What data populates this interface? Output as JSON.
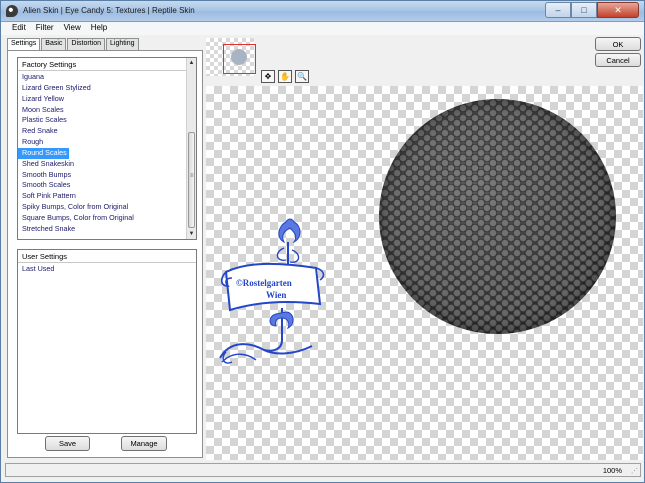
{
  "title": "Alien Skin | Eye Candy 5: Textures | Reptile Skin",
  "window_buttons": {
    "minimize": "–",
    "maximize": "□",
    "close": "✕"
  },
  "menu": [
    "Edit",
    "Filter",
    "View",
    "Help"
  ],
  "tabs": [
    "Settings",
    "Basic",
    "Distortion",
    "Lighting"
  ],
  "factory_settings": {
    "header": "Factory Settings",
    "items": [
      "Iguana",
      "Lizard Green Stylized",
      "Lizard Yellow",
      "Moon Scales",
      "Plastic Scales",
      "Red Snake",
      "Rough",
      "Round Scales",
      "Shed Snakeskin",
      "Smooth Bumps",
      "Smooth Scales",
      "Soft Pink Pattern",
      "Spiky Bumps, Color from Original",
      "Square Bumps, Color from Original",
      "Stretched Snake"
    ],
    "selected": "Round Scales"
  },
  "user_settings": {
    "header": "User Settings",
    "items": [
      "Last Used"
    ]
  },
  "buttons": {
    "save": "Save",
    "manage": "Manage",
    "ok": "OK",
    "cancel": "Cancel"
  },
  "logo_text": {
    "line1": "©Rostelgarten",
    "line2": "Wien"
  },
  "status": {
    "zoom": "100%"
  },
  "colors": {
    "selection": "#3399ff",
    "logo": "#2446c9",
    "thumb_frame": "#e03030"
  },
  "icons": {
    "tool1": "hand-grab-icon",
    "tool2": "hand-pan-icon",
    "tool3": "zoom-icon"
  }
}
